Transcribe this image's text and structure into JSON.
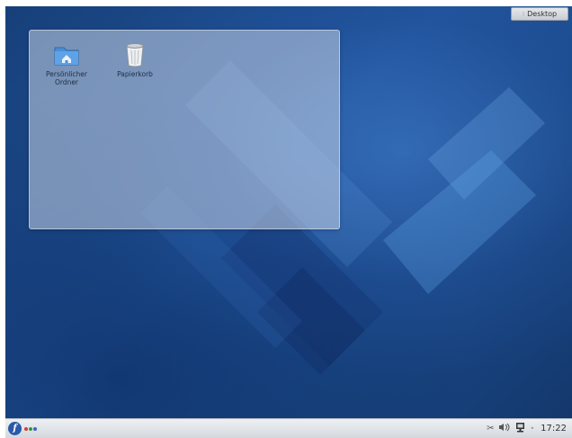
{
  "desktop_button": {
    "label": "Desktop"
  },
  "desktop_icons": [
    {
      "label": "Persönlicher Ordner",
      "icon": "home-folder-icon"
    },
    {
      "label": "Papierkorb",
      "icon": "trash-icon"
    }
  ],
  "taskbar": {
    "clock": "17:22",
    "tray_icons": [
      "clipboard-icon",
      "volume-icon",
      "network-icon"
    ],
    "pager_colors": [
      "#d23c3c",
      "#2f9a3a",
      "#3b63c9"
    ]
  }
}
